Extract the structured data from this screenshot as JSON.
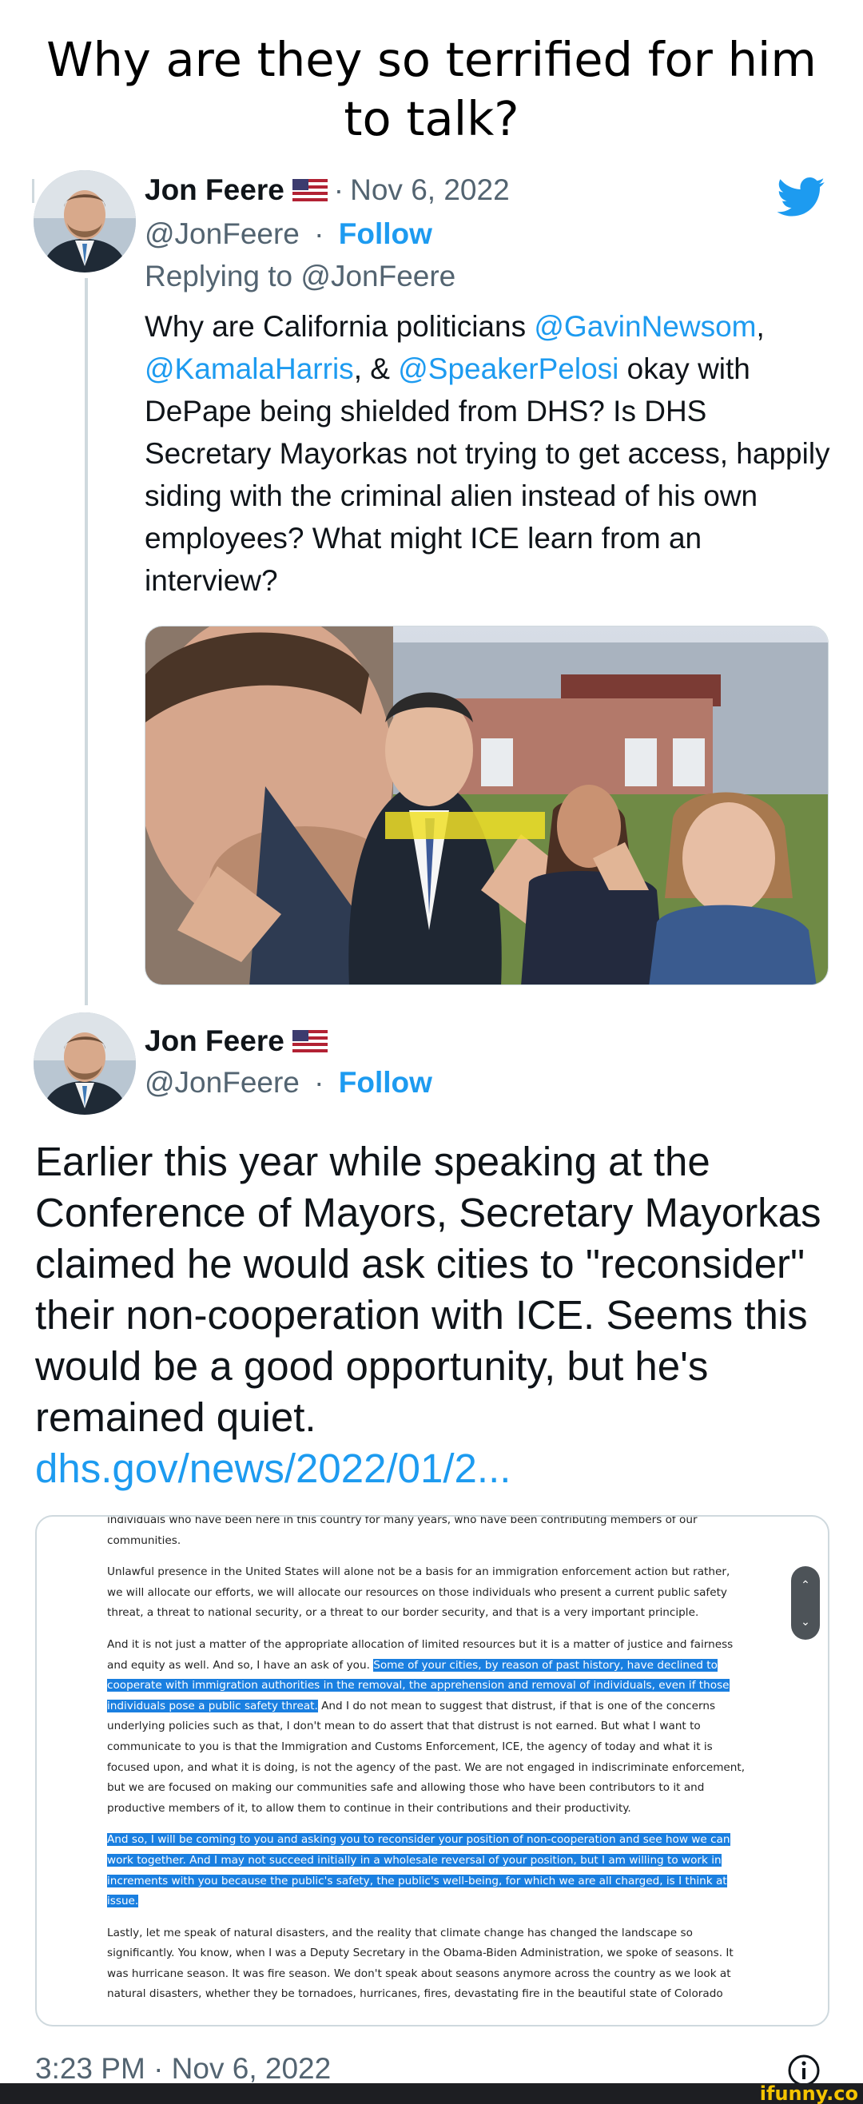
{
  "meme": {
    "title_line1": "Why are they so terrified for him",
    "title_line2": "to talk?"
  },
  "reply_tweet": {
    "name": "Jon Feere",
    "date": "Nov 6, 2022",
    "handle": "@JonFeere",
    "follow_label": "Follow",
    "replying_prefix": "Replying to",
    "replying_to": "@JonFeere",
    "text_part1": "Why are California politicians ",
    "mention1": "@GavinNewsom",
    "text_part2": ",",
    "mention2": "@KamalaHarris",
    "text_part3": ", & ",
    "mention3": "@SpeakerPelosi",
    "text_part4": " okay with DePape being shielded from DHS? Is DHS Secretary Mayorkas not trying to get access, happily siding with the criminal alien instead of his own employees? What might ICE learn from an interview?"
  },
  "main_tweet": {
    "name": "Jon Feere",
    "handle": "@JonFeere",
    "follow_label": "Follow",
    "text": "Earlier this year while speaking at the Conference of Mayors, Secretary Mayorkas claimed he would ask cities to \"reconsider\" their non-cooperation with ICE. Seems this would be a good opportunity, but he's remained quiet.",
    "link": "dhs.gov/news/2022/01/2...",
    "timestamp": "3:23 PM · Nov 6, 2022"
  },
  "document": {
    "p1": "individuals who have been here in this country for many years, who have been contributing members of our communities.",
    "p2": "Unlawful presence in the United States will alone not be a basis for an immigration enforcement action but rather, we will allocate our efforts, we will allocate our resources on those individuals who present a current public safety threat, a threat to national security, or a threat to our border security, and that is a very important principle.",
    "p3a": "And it is not just a matter of the appropriate allocation of limited resources but it is a matter of justice and fairness and equity as well. And so, I have an ask of you. ",
    "p3_highlight": "Some of your cities, by reason of past history, have declined to cooperate with immigration authorities in the removal, the apprehension and removal of individuals, even if those individuals pose a public safety threat.",
    "p3b": " And I do not mean to suggest that distrust, if that is one of the concerns underlying policies such as that, I don't mean to do assert that that distrust is not earned. But what I want to communicate to you is that the Immigration and Customs Enforcement, ICE, the agency of today and what it is focused upon, and what it is doing, is not the agency of the past. We are not engaged in indiscriminate enforcement, but we are focused on making our communities safe and allowing those who have been contributors to it and productive members of it, to allow them to continue in their contributions and their productivity.",
    "p4_highlight": "And so, I will be coming to you and asking you to reconsider your position of non-cooperation and see how we can work together. And I may not succeed initially in a wholesale reversal of your position, but I am willing to work in increments with you because the public's safety, the public's well-being, for which we are all charged, is I think at issue.",
    "p5": "Lastly, let me speak of natural disasters, and the reality that climate change has changed the landscape so significantly. You know, when I was a Deputy Secretary in the Obama-Biden Administration, we spoke of seasons. It was hurricane season. It was fire season. We don't speak about seasons anymore across the country as we look at natural disasters, whether they be tornadoes, hurricanes, fires, devastating fire in the beautiful state of Colorado"
  },
  "footer": {
    "watermark": "ifunny.co"
  },
  "icons": {
    "brand": "twitter-bird-icon",
    "flag": "us-flag-icon",
    "info": "info-icon"
  },
  "colors": {
    "accent": "#1d9bf0",
    "muted": "#536471",
    "highlight": "#1a7fe0",
    "watermark": "#f5c400"
  }
}
